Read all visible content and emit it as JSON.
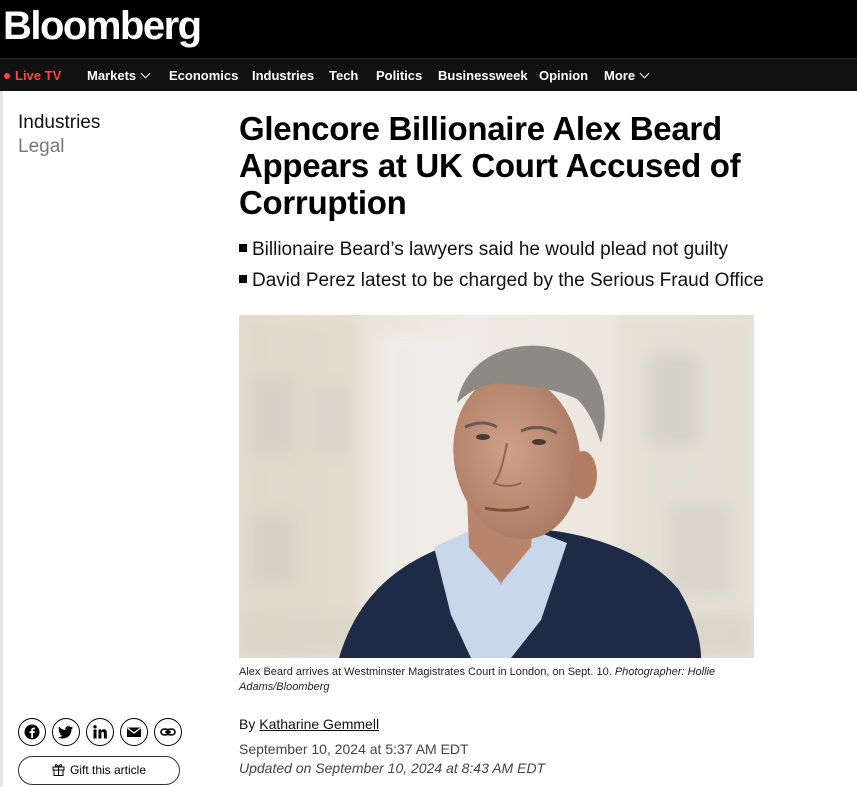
{
  "brand": {
    "logo_text": "Bloomberg"
  },
  "nav": {
    "live_label": "Live TV",
    "items": [
      "Markets",
      "Economics",
      "Industries",
      "Tech",
      "Politics",
      "Businessweek",
      "Opinion",
      "More"
    ],
    "live_color": "#ff433d"
  },
  "article": {
    "section_primary": "Industries",
    "section_secondary": "Legal",
    "headline": "Glencore Billionaire Alex Beard Appears at UK Court Accused of Corruption",
    "bullets": [
      "Billionaire Beard’s lawyers said he would plead not guilty",
      "David Perez latest to be charged by the Serious Fraud Office"
    ],
    "caption": "Alex Beard arrives at Westminster Magistrates Court in London, on Sept. 10.",
    "photo_credit": "Photographer: Hollie Adams/Bloomberg",
    "byline_prefix": "By",
    "author": "Katharine Gemmell",
    "published": "September 10, 2024 at 5:37 AM EDT",
    "updated": "Updated on September 10, 2024 at 8:43 AM EDT"
  },
  "share": {
    "icons": [
      "facebook-icon",
      "twitter-icon",
      "linkedin-icon",
      "email-icon",
      "link-icon"
    ],
    "gift_label": "Gift this article"
  }
}
